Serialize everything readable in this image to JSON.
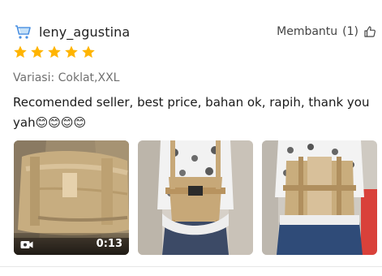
{
  "review": {
    "username": "leny_agustina",
    "helpful": {
      "label": "Membantu",
      "count": "(1)"
    },
    "rating": 5,
    "rating_max": 5,
    "variant": "Variasi: Coklat,XXL",
    "comment": "Recomended seller, best price, bahan ok, rapih, thank you yah😊😊😊😊",
    "media": [
      {
        "type": "video",
        "duration": "0:13",
        "icon": "video-camera-icon"
      },
      {
        "type": "image"
      },
      {
        "type": "image"
      }
    ]
  },
  "colors": {
    "star": "#FFB400",
    "avatar_accent": "#4A90E2",
    "brace": "#C9AE7E"
  }
}
